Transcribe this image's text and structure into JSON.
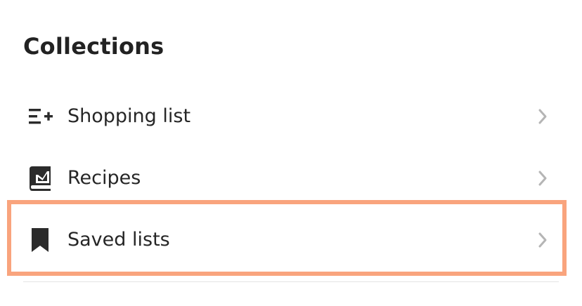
{
  "header": {
    "title": "Collections"
  },
  "items": [
    {
      "label": "Shopping list",
      "icon": "list-add-icon"
    },
    {
      "label": "Recipes",
      "icon": "recipe-book-icon"
    },
    {
      "label": "Saved lists",
      "icon": "bookmark-icon"
    }
  ],
  "colors": {
    "highlight": "#f9a47d",
    "icon": "#2b2b2b",
    "chevron": "#b5b5b5"
  }
}
